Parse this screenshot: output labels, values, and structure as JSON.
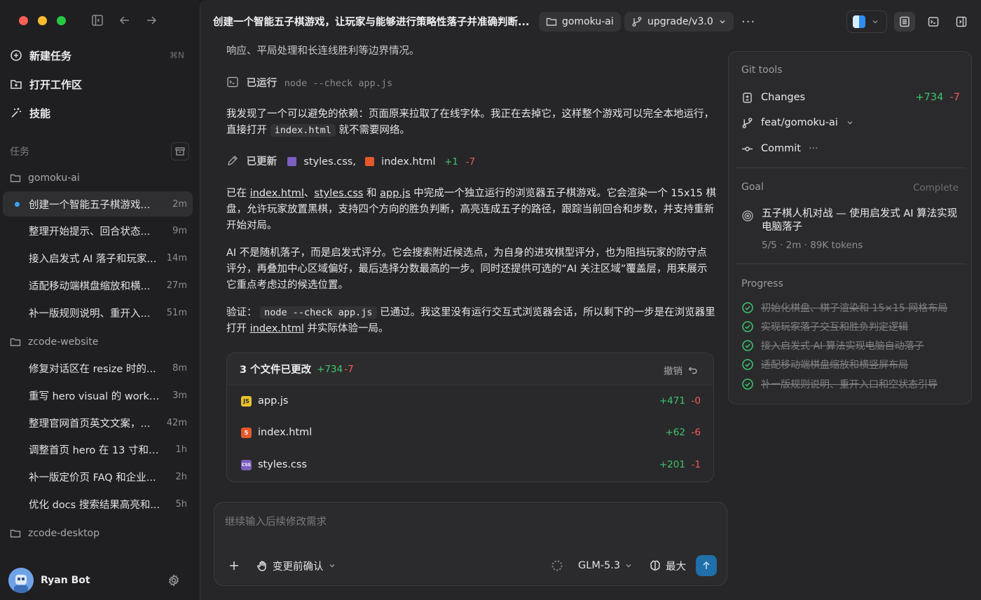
{
  "sidebar": {
    "new_task": "新建任务",
    "new_task_shortcut": "⌘N",
    "open_workspace": "打开工作区",
    "skills": "技能",
    "section_label": "任务",
    "groups": [
      {
        "name": "gomoku-ai",
        "tasks": [
          {
            "title": "创建一个智能五子棋游戏...",
            "time": "2m"
          },
          {
            "title": "整理开始提示、回合状态...",
            "time": "9m"
          },
          {
            "title": "接入启发式 AI 落子和玩家...",
            "time": "14m"
          },
          {
            "title": "适配移动端棋盘缩放和横...",
            "time": "27m"
          },
          {
            "title": "补一版规则说明、重开入...",
            "time": "51m"
          }
        ]
      },
      {
        "name": "zcode-website",
        "tasks": [
          {
            "title": "修复对话区在 resize 时的...",
            "time": "8m"
          },
          {
            "title": "重写 hero visual 的 works...",
            "time": "3m"
          },
          {
            "title": "整理官网首页英文文案，...",
            "time": "42m"
          },
          {
            "title": "调整首页 hero 在 13 寸和移...",
            "time": "1h"
          },
          {
            "title": "补一版定价页 FAQ 和企业...",
            "time": "2h"
          },
          {
            "title": "优化 docs 搜索结果高亮和...",
            "time": "5h"
          }
        ]
      },
      {
        "name": "zcode-desktop",
        "tasks": []
      }
    ],
    "user_name": "Ryan Bot"
  },
  "header": {
    "title": "创建一个智能五子棋游戏，让玩家与能够进行策略性落子并准确判断...",
    "project_chip": "gomoku-ai",
    "branch_chip": "upgrade/v3.0",
    "more": "···"
  },
  "chat": {
    "line0": "响应、平局处理和长连线胜利等边界情况。",
    "ran_label": "已运行",
    "ran_cmd": "node --check app.js",
    "p1_a": "我发现了一个可以避免的依赖：页面原来拉取了在线字体。我正在去掉它，这样整个游戏可以完全本地运行，直接打开",
    "p1_code": "index.html",
    "p1_b": "就不需要网络。",
    "updated_label": "已更新",
    "updated_file1": "styles.css",
    "updated_sep": ",",
    "updated_file2": "index.html",
    "updated_plus": "+1",
    "updated_minus": "-7",
    "p2_a": "已在",
    "p2_f1": "index.html",
    "p2_s1": "、",
    "p2_f2": "styles.css",
    "p2_s2": "和",
    "p2_f3": "app.js",
    "p2_b": "中完成一个独立运行的浏览器五子棋游戏。它会渲染一个 15x15 棋盘，允许玩家放置黑棋，支持四个方向的胜负判断，高亮连成五子的路径，跟踪当前回合和步数，并支持重新开始对局。",
    "p3": "AI 不是随机落子，而是启发式评分。它会搜索附近候选点，为自身的进攻棋型评分，也为阻挡玩家的防守点评分，再叠加中心区域偏好，最后选择分数最高的一步。同时还提供可选的“AI 关注区域”覆盖层，用来展示它重点考虑过的候选位置。",
    "p4_a": "验证：",
    "p4_code": "node --check app.js",
    "p4_b": "已通过。我这里没有运行交互式浏览器会话，所以剩下的一步是在浏览器里打开",
    "p4_link": "index.html",
    "p4_c": "并实际体验一局。"
  },
  "files_box": {
    "title": "3 个文件已更改",
    "plus": "+734",
    "minus": "-7",
    "undo": "撤销",
    "files": [
      {
        "name": "app.js",
        "icon": "JS",
        "plus": "+471",
        "minus": "-0"
      },
      {
        "name": "index.html",
        "icon": "5",
        "plus": "+62",
        "minus": "-6"
      },
      {
        "name": "styles.css",
        "icon": "CSS",
        "plus": "+201",
        "minus": "-1"
      }
    ]
  },
  "composer": {
    "placeholder": "继续输入后续修改需求",
    "mode": "变更前确认",
    "model": "GLM-5.3",
    "effort": "最大"
  },
  "git_panel": {
    "title": "Git tools",
    "changes_label": "Changes",
    "changes_plus": "+734",
    "changes_minus": "-7",
    "branch": "feat/gomoku-ai",
    "commit": "Commit",
    "commit_more": "···",
    "goal_label": "Goal",
    "goal_status": "Complete",
    "goal_text": "五子棋人机对战 — 使用启发式 AI 算法实现电脑落子",
    "goal_meta": "5/5 · 2m · 89K tokens",
    "progress_label": "Progress",
    "progress_items": [
      "初始化棋盘、棋子渲染和 15×15 网格布局",
      "实现玩家落子交互和胜负判定逻辑",
      "接入启发式 AI 算法实现电脑自动落子",
      "适配移动端棋盘缩放和横竖屏布局",
      "补一版规则说明、重开入口和空状态引导"
    ]
  },
  "colors": {
    "accent": "#3aa2ff",
    "added": "#3ec46d",
    "removed": "#f25a5a",
    "send": "#1f6fa8"
  }
}
